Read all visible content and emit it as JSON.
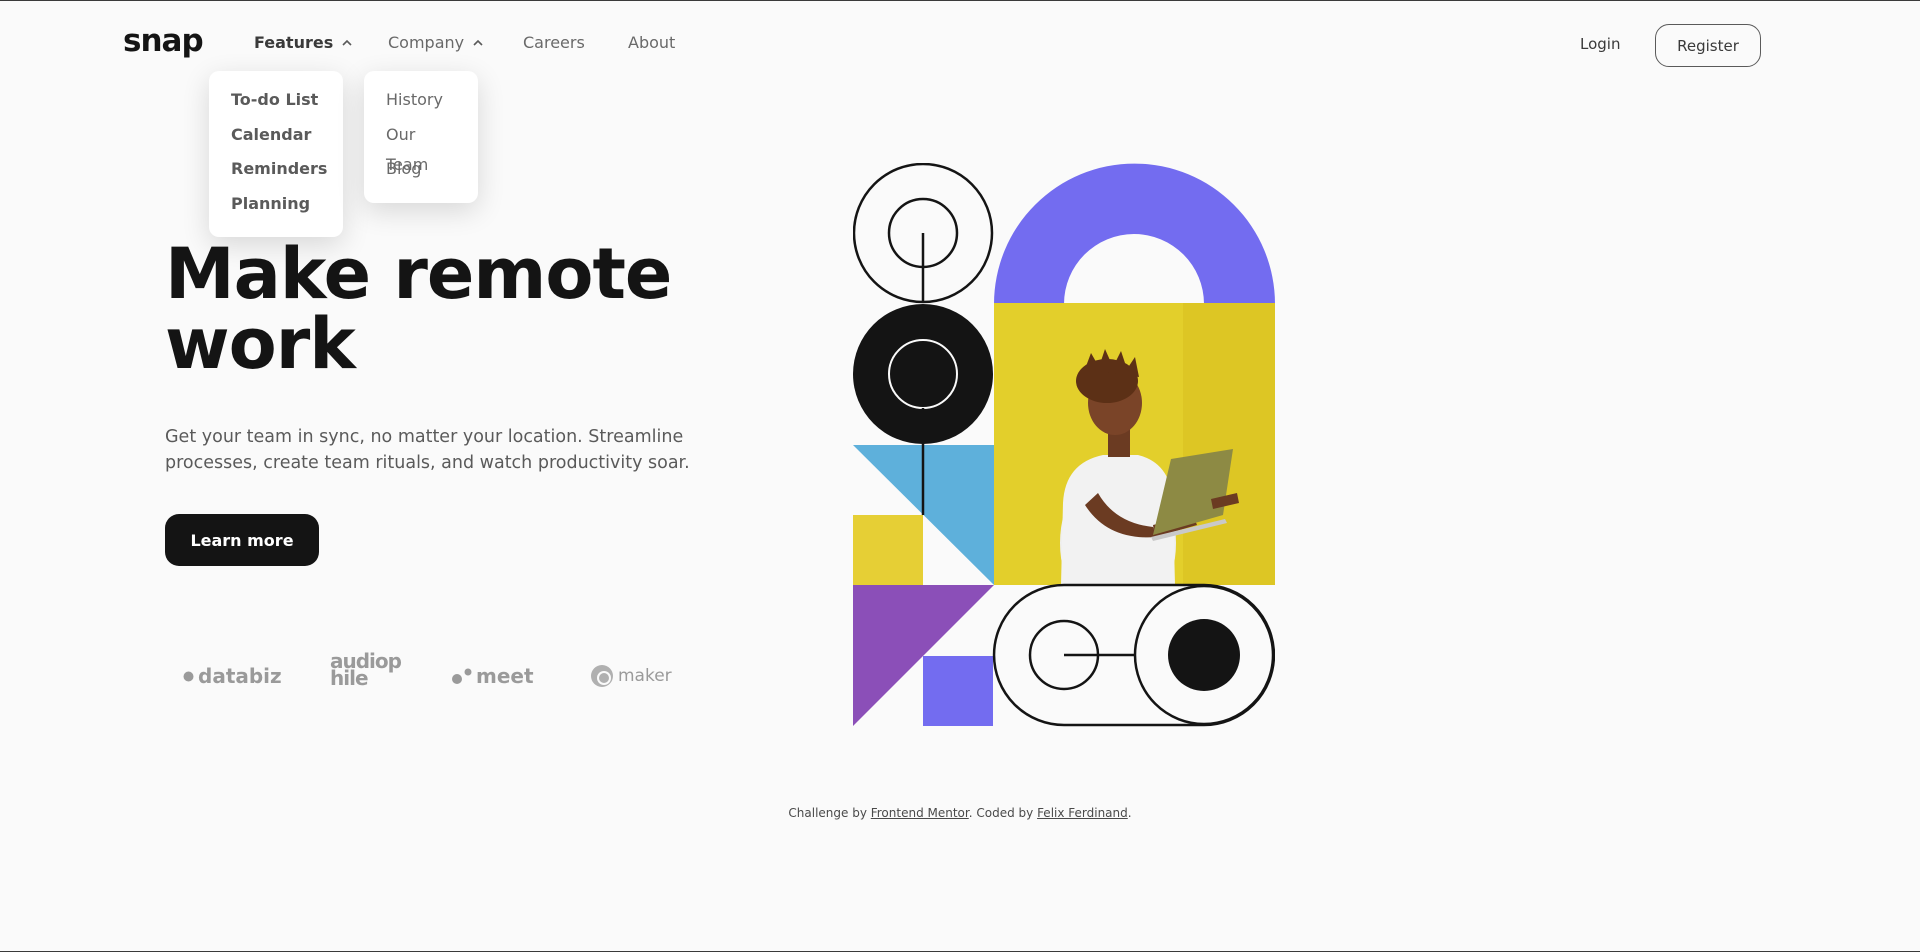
{
  "brand": {
    "logo": "snap"
  },
  "nav": {
    "features": "Features",
    "company": "Company",
    "careers": "Careers",
    "about": "About",
    "login": "Login",
    "register": "Register"
  },
  "features_menu": [
    "To-do List",
    "Calendar",
    "Reminders",
    "Planning"
  ],
  "company_menu": [
    "History",
    "Our Team",
    "Blog"
  ],
  "hero": {
    "title_line1": "Make remote",
    "title_line2": "work",
    "description": "Get your team in sync, no matter your location. Streamline processes, create team rituals, and watch productivity soar.",
    "cta": "Learn more"
  },
  "clients": [
    "databiz",
    "audiophile",
    "meet",
    "maker"
  ],
  "footer": {
    "prefix": "Challenge by ",
    "link1": "Frontend Mentor",
    "middle": ". Coded by ",
    "link2": "Felix Ferdinand",
    "suffix": "."
  },
  "colors": {
    "purple": "#736cf0",
    "yellow": "#e6cf35",
    "blue": "#5eb0db",
    "violet": "#8b4fb8",
    "dark": "#141414"
  }
}
